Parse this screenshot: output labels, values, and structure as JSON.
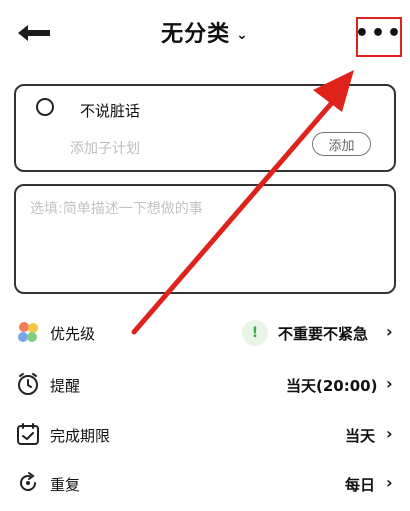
{
  "header": {
    "title": "无分类",
    "chevron": "⌄",
    "more_icon": "•••"
  },
  "task": {
    "title": "不说脏话",
    "subplan_placeholder": "添加子计划",
    "add_label": "添加"
  },
  "description": {
    "placeholder": "选填:简单描述一下想做的事"
  },
  "rows": [
    {
      "label": "优先级",
      "value": "不重要不紧急",
      "icon": "priority-icon"
    },
    {
      "label": "提醒",
      "value": "当天(20:00)",
      "icon": "alarm-clock-icon"
    },
    {
      "label": "完成期限",
      "value": "当天",
      "icon": "calendar-check-icon"
    },
    {
      "label": "重复",
      "value": "每日",
      "icon": "repeat-icon"
    }
  ],
  "priority_badge": "!",
  "colors": {
    "accent_red": "#e0221c",
    "badge_green": "#3aa94a"
  }
}
